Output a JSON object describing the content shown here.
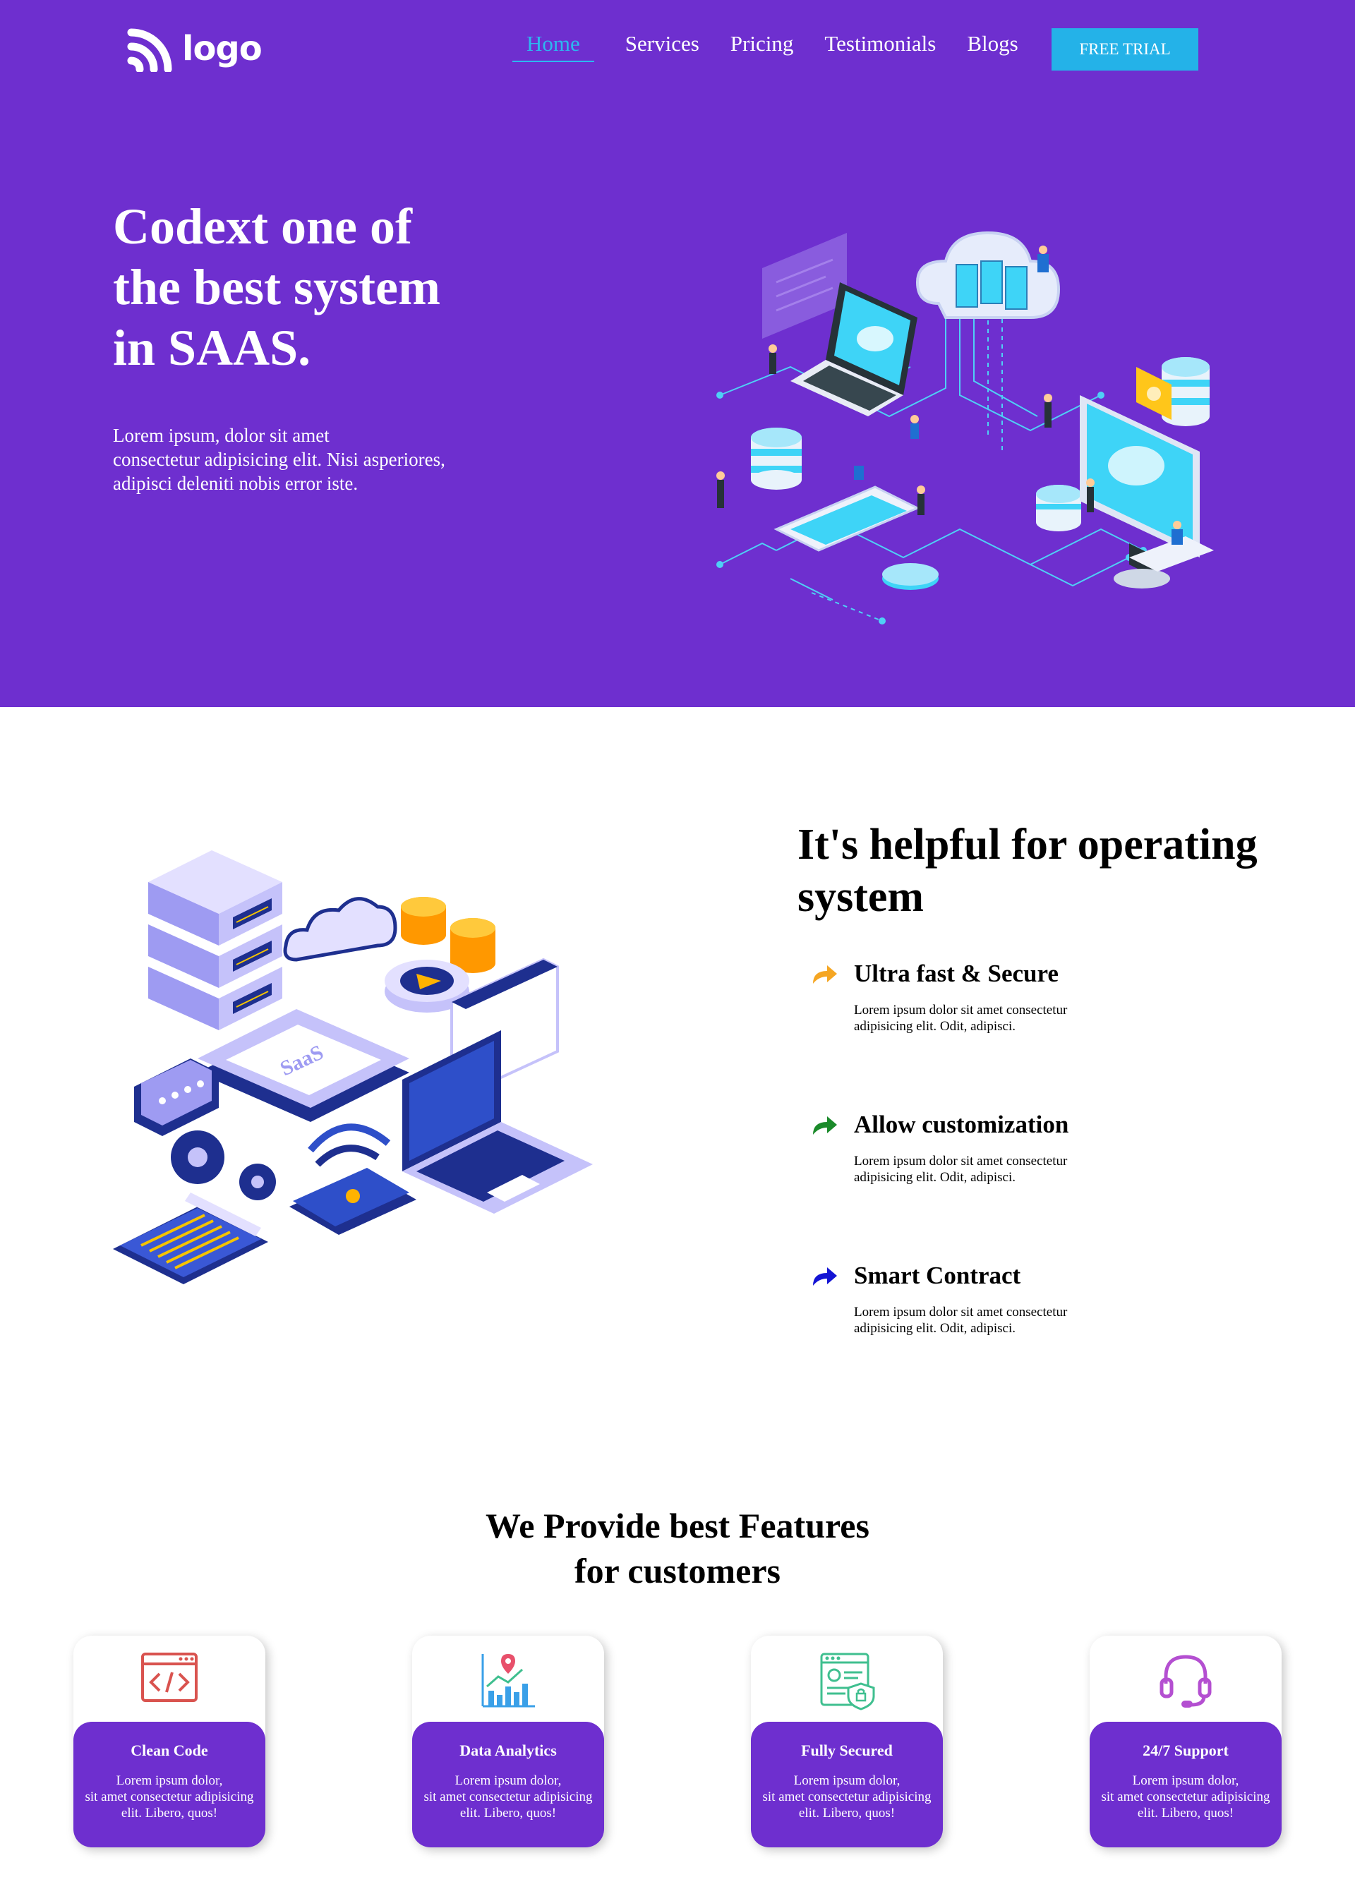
{
  "nav": {
    "logo_text": "logo",
    "links": [
      "Home",
      "Services",
      "Pricing",
      "Testimonials",
      "Blogs"
    ],
    "active": "Home",
    "cta": "FREE TRIAL"
  },
  "hero": {
    "title_lines": [
      "Codext one of",
      "the best system",
      "in SAAS."
    ],
    "desc_lines": [
      "Lorem ipsum, dolor sit amet",
      "consectetur adipisicing elit. Nisi asperiores,",
      "adipisci deleniti nobis error iste."
    ]
  },
  "helpful": {
    "title_lines": [
      "It's helpful for operating",
      "system"
    ],
    "saas_label": "SaaS",
    "items": [
      {
        "title": "Ultra fast & Secure",
        "desc_lines": [
          "Lorem ipsum dolor sit amet consectetur",
          "adipisicing elit. Odit, adipisci."
        ],
        "arrow_color": "#f5a623"
      },
      {
        "title": "Allow customization",
        "desc_lines": [
          "Lorem ipsum dolor sit amet consectetur",
          "adipisicing elit. Odit, adipisci."
        ],
        "arrow_color": "#1a8a2a"
      },
      {
        "title": "Smart Contract",
        "desc_lines": [
          "Lorem ipsum dolor sit amet consectetur",
          "adipisicing elit. Odit, adipisci."
        ],
        "arrow_color": "#1414d4"
      }
    ]
  },
  "features": {
    "title_lines": [
      "We Provide best Features",
      "for customers"
    ],
    "cards": [
      {
        "title": "Clean Code",
        "desc_lines": [
          "Lorem ipsum dolor,",
          "sit amet consectetur adipisicing",
          "elit. Libero, quos!"
        ],
        "icon": "code-window-icon",
        "icon_color": "#d9534f"
      },
      {
        "title": "Data Analytics",
        "desc_lines": [
          "Lorem ipsum dolor,",
          "sit amet consectetur adipisicing",
          "elit. Libero, quos!"
        ],
        "icon": "analytics-chart-icon",
        "icon_color": "#3aa0e8"
      },
      {
        "title": "Fully Secured",
        "desc_lines": [
          "Lorem ipsum dolor,",
          "sit amet consectetur adipisicing",
          "elit. Libero, quos!"
        ],
        "icon": "secure-document-icon",
        "icon_color": "#3fbf8f"
      },
      {
        "title": "24/7 Support",
        "desc_lines": [
          "Lorem ipsum dolor,",
          "sit amet consectetur adipisicing",
          "elit. Libero, quos!"
        ],
        "icon": "headset-icon",
        "icon_color": "#b44fd1"
      }
    ]
  },
  "colors": {
    "brand_purple": "#6e2fcf",
    "accent_cyan": "#24b2e8",
    "active_link": "#2cb8f0"
  }
}
